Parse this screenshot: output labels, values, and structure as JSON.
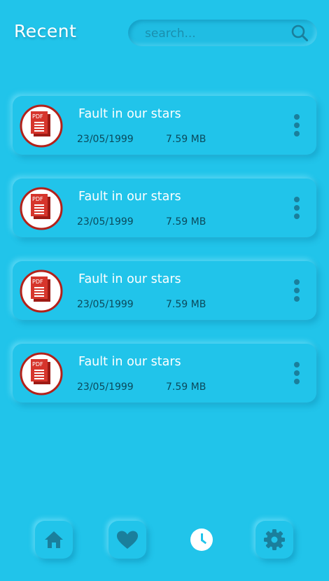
{
  "header": {
    "title": "Recent",
    "search_placeholder": "search..."
  },
  "files": [
    {
      "name": "Fault in our stars",
      "date": "23/05/1999",
      "size": "7.59 MB",
      "icon": "pdf-icon"
    },
    {
      "name": "Fault in our stars",
      "date": "23/05/1999",
      "size": "7.59 MB",
      "icon": "pdf-icon"
    },
    {
      "name": "Fault in our stars",
      "date": "23/05/1999",
      "size": "7.59 MB",
      "icon": "pdf-icon"
    },
    {
      "name": "Fault in our stars",
      "date": "23/05/1999",
      "size": "7.59 MB",
      "icon": "pdf-icon"
    }
  ],
  "pdf_badge": "PDF",
  "nav": {
    "items": [
      {
        "icon": "home-icon"
      },
      {
        "icon": "heart-icon"
      },
      {
        "icon": "clock-icon",
        "active": true
      },
      {
        "icon": "gear-icon"
      }
    ]
  },
  "colors": {
    "background": "#21c4ea",
    "nav_icon": "#1a7f9c",
    "pdf_red": "#c8261e"
  }
}
